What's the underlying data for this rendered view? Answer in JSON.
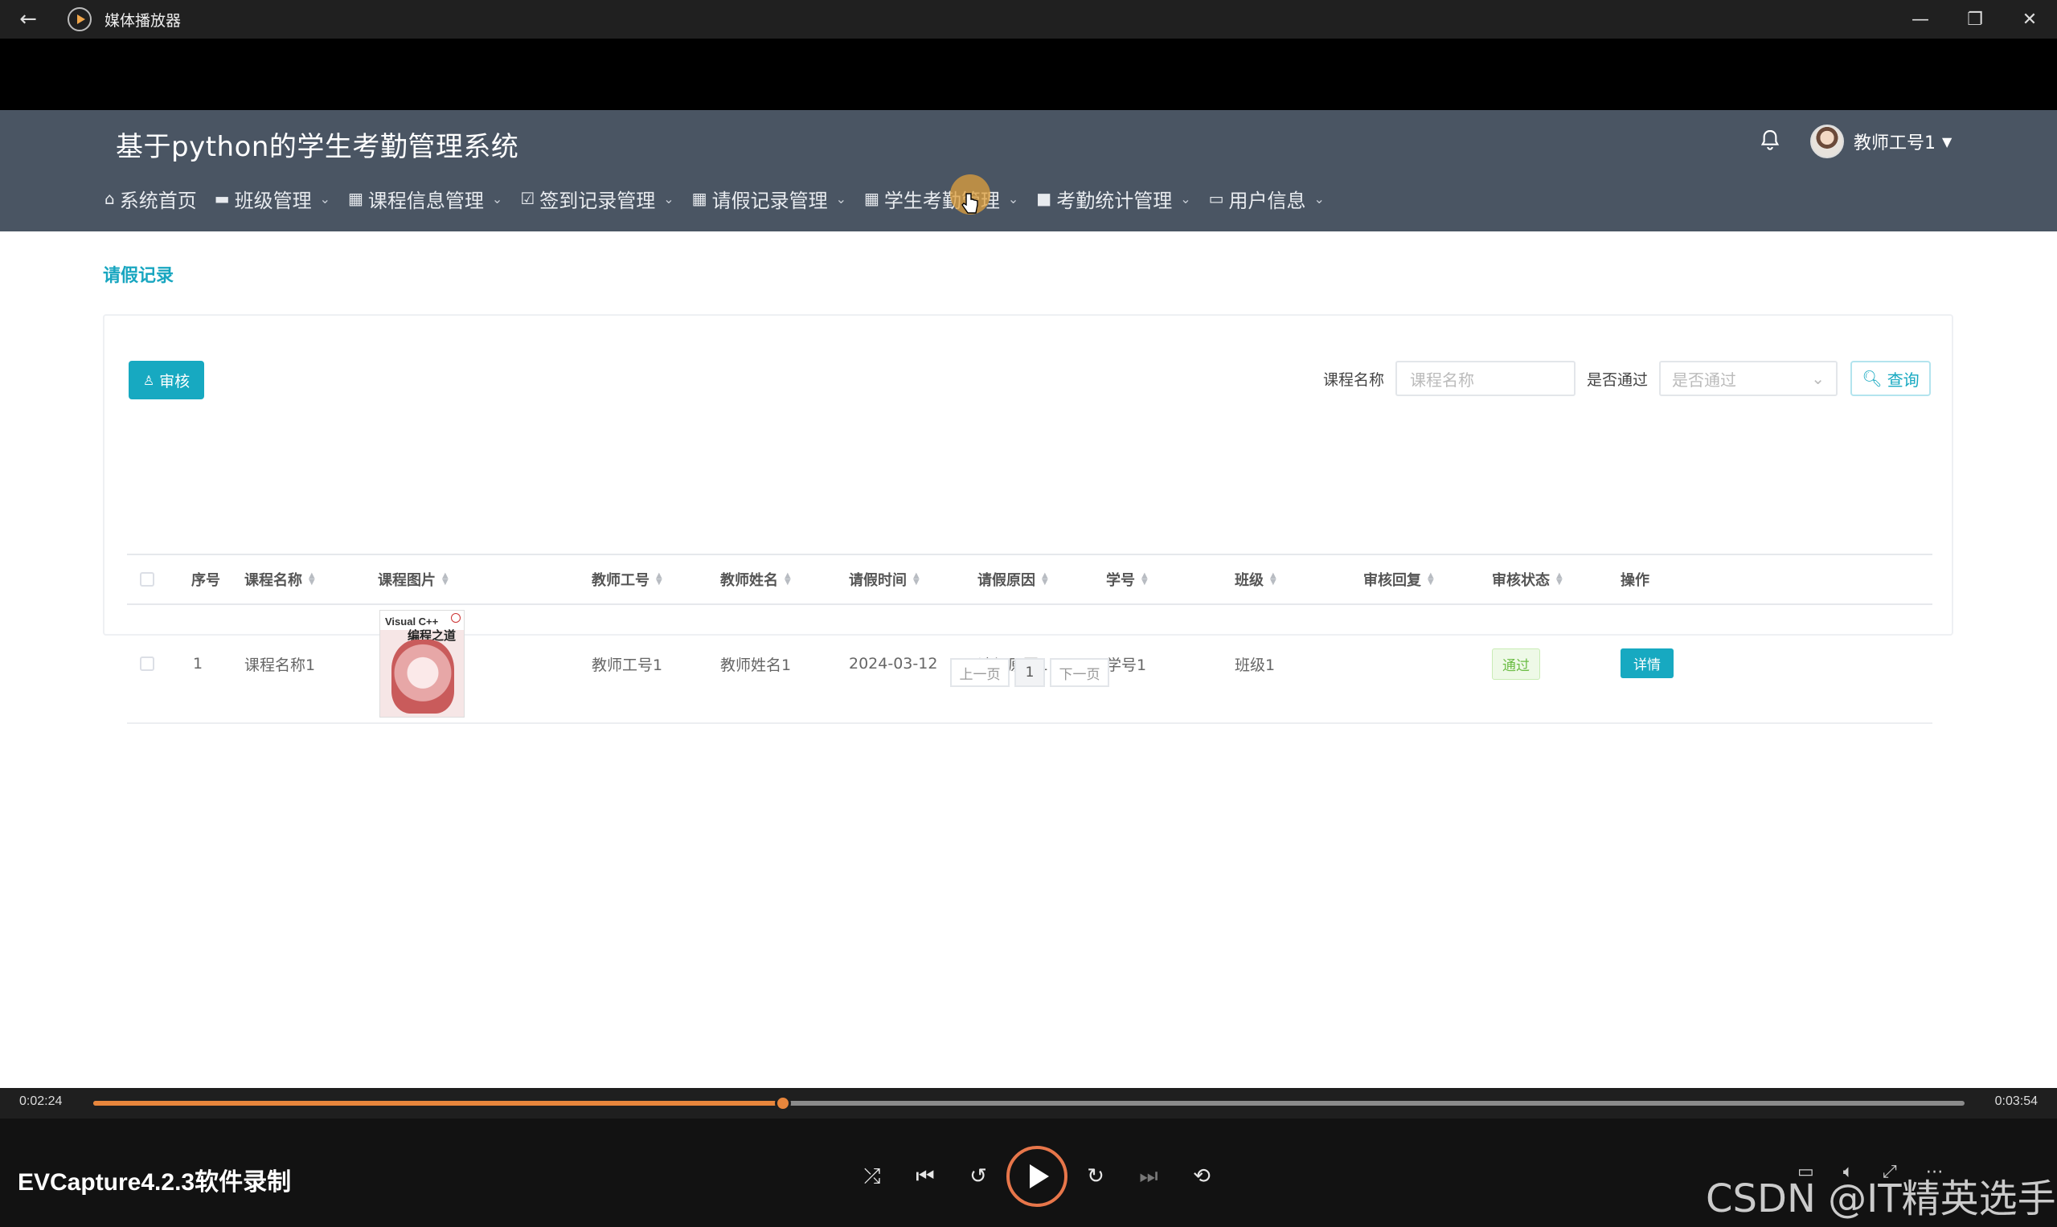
{
  "player": {
    "title": "媒体播放器",
    "current_time": "0:02:24",
    "total_time": "0:03:54",
    "progress_fraction": 0.3686,
    "recording_title": "EVCapture4.2.3软件录制",
    "watermark": "CSDN @IT精英选手",
    "accent_color": "#e8863c"
  },
  "app": {
    "system_title": "基于python的学生考勤管理系统",
    "user_name": "教师工号1",
    "header_color": "#4a5563",
    "accent_color": "#17a9c1",
    "nav": [
      {
        "label": "系统首页",
        "icon": "home-icon",
        "has_menu": false
      },
      {
        "label": "班级管理",
        "icon": "chat-icon",
        "has_menu": true
      },
      {
        "label": "课程信息管理",
        "icon": "grid-icon",
        "has_menu": true
      },
      {
        "label": "签到记录管理",
        "icon": "check-icon",
        "has_menu": true
      },
      {
        "label": "请假记录管理",
        "icon": "grid-icon",
        "has_menu": true
      },
      {
        "label": "学生考勤管理",
        "icon": "grid-icon",
        "has_menu": true
      },
      {
        "label": "考勤统计管理",
        "icon": "camera-icon",
        "has_menu": true
      },
      {
        "label": "用户信息",
        "icon": "card-icon",
        "has_menu": true
      }
    ],
    "breadcrumb": "请假记录",
    "audit_button": "审核",
    "search": {
      "course_label": "课程名称",
      "course_placeholder": "课程名称",
      "pass_label": "是否通过",
      "pass_placeholder": "是否通过",
      "query_button": "查询"
    },
    "table": {
      "headers": [
        "序号",
        "课程名称",
        "课程图片",
        "教师工号",
        "教师姓名",
        "请假时间",
        "请假原因",
        "学号",
        "班级",
        "审核回复",
        "审核状态",
        "操作"
      ],
      "rows": [
        {
          "index": "1",
          "course_name": "课程名称1",
          "cover_title_1": "Visual C++",
          "cover_title_2": "编程之道",
          "teacher_id": "教师工号1",
          "teacher_name": "教师姓名1",
          "leave_date": "2024-03-12",
          "leave_reason": "请假原因1",
          "student_id": "学号1",
          "class_name": "班级1",
          "audit_reply": "",
          "audit_status": "通过",
          "action": "详情"
        }
      ]
    },
    "pager": {
      "prev": "上一页",
      "page": "1",
      "next": "下一页"
    }
  }
}
